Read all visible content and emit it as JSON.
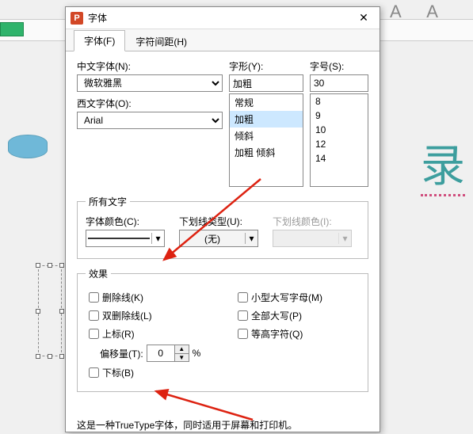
{
  "dialog": {
    "title": "字体",
    "close_glyph": "✕",
    "tabs": {
      "font": "字体(F)",
      "spacing": "字符间距(H)"
    },
    "labels": {
      "cjk_font": "中文字体(N):",
      "latin_font": "西文字体(O):",
      "style": "字形(Y):",
      "size": "字号(S):"
    },
    "values": {
      "cjk_font": "微软雅黑",
      "latin_font": "Arial",
      "style_input": "加粗",
      "size_input": "30"
    },
    "style_options": [
      "常规",
      "加粗",
      "倾斜",
      "加粗 倾斜"
    ],
    "style_selected_index": 1,
    "size_options": [
      "8",
      "9",
      "10",
      "12",
      "14"
    ],
    "all_text_group": {
      "legend": "所有文字",
      "font_color_label": "字体颜色(C):",
      "font_color": "#2a5fd6",
      "underline_type_label": "下划线类型(U):",
      "underline_type_value": "(无)",
      "underline_color_label": "下划线颜色(I):"
    },
    "effects_group": {
      "legend": "效果",
      "strike": "删除线(K)",
      "dbl_strike": "双删除线(L)",
      "superscript": "上标(R)",
      "offset_label": "偏移量(T):",
      "offset_value": "0",
      "offset_unit": "%",
      "subscript": "下标(B)",
      "smallcaps": "小型大写字母(M)",
      "allcaps": "全部大写(P)",
      "equalize": "等高字符(Q)"
    },
    "footer_desc": "这是一种TrueType字体，同时适用于屏幕和打印机。"
  },
  "bg": {
    "aa": "A A",
    "lu": "录"
  }
}
